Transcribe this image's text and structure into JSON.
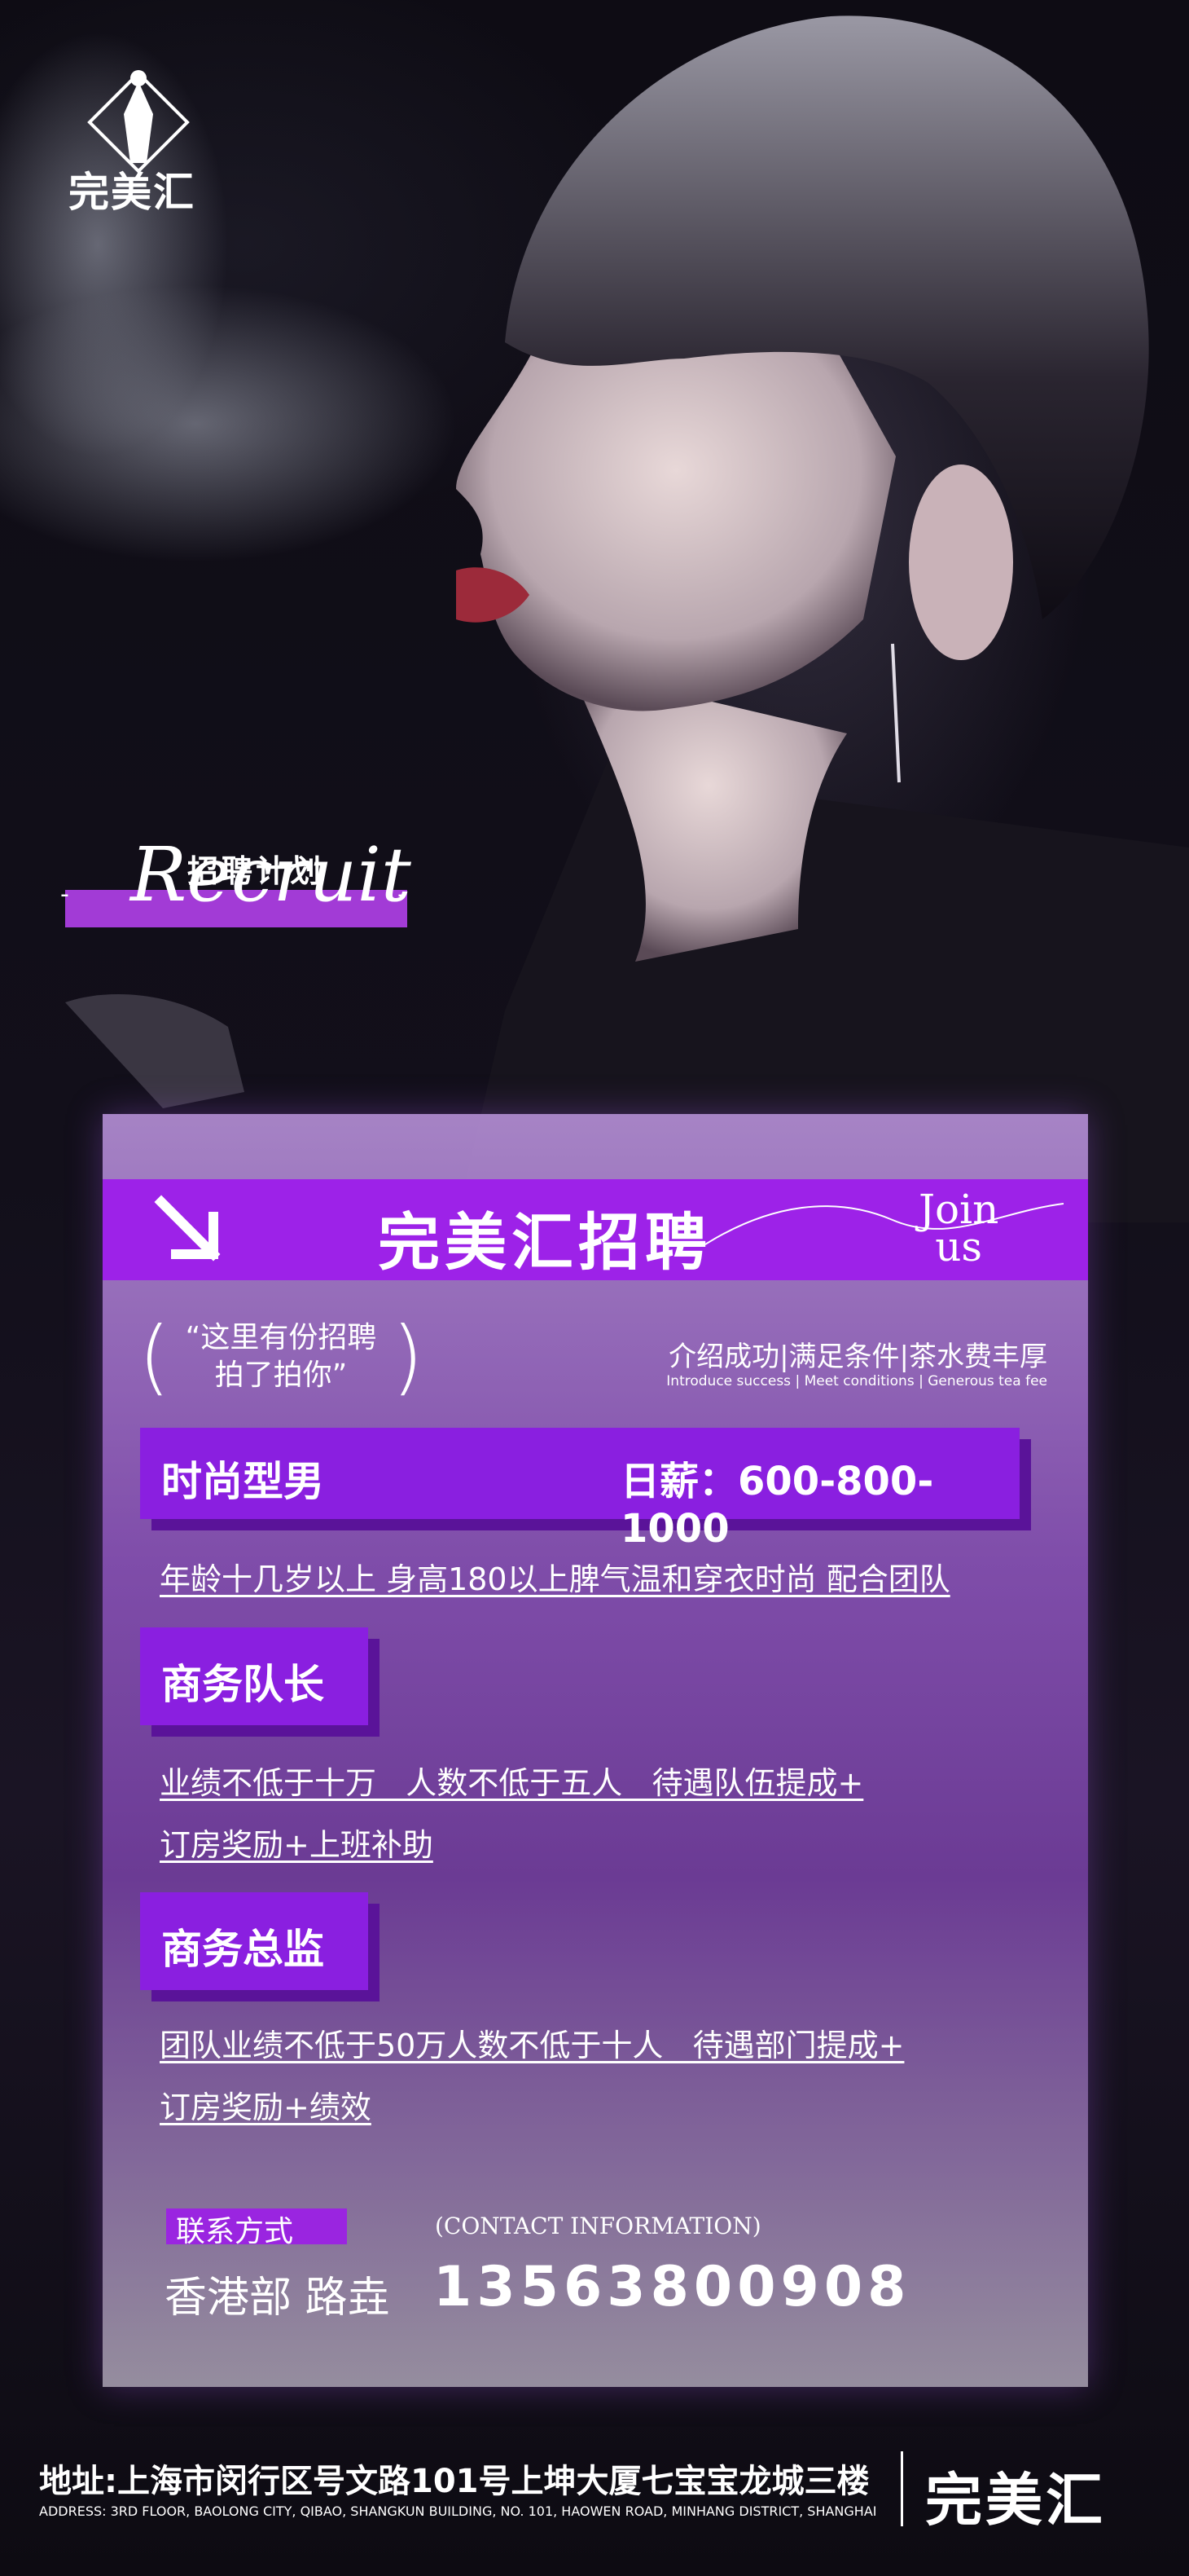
{
  "brand": {
    "logo_text": "完美汇"
  },
  "recruit_badge": {
    "cn": "招聘计划",
    "en": "Recruit",
    "dash": "-"
  },
  "header": {
    "title": "完美汇招聘",
    "join_line1": "Join",
    "join_line2": "us"
  },
  "intro": {
    "quote_line1": "“这里有份招聘",
    "quote_line2": "拍了拍你”",
    "open_paren": "(",
    "close_paren": ")",
    "benefits_cn": "介绍成功|满足条件|茶水费丰厚",
    "benefits_en": "Introduce success | Meet conditions | Generous tea fee"
  },
  "jobs": [
    {
      "title": "时尚型男",
      "salary": "日薪：600-800-1000",
      "req_line1": "年龄十几岁以上 身高180以上脾气温和穿衣时尚 配合团队",
      "req_line2": ""
    },
    {
      "title": "商务队长",
      "salary": "",
      "req_line1": "业绩不低于十万   人数不低于五人   待遇队伍提成+",
      "req_line2": "订房奖励+上班补助"
    },
    {
      "title": "商务总监",
      "salary": "",
      "req_line1": "团队业绩不低于50万人数不低于十人   待遇部门提成+",
      "req_line2": "订房奖励+绩效"
    }
  ],
  "contact": {
    "label": "联系方式",
    "label_en": "(CONTACT INFORMATION)",
    "name": "香港部 路垚",
    "phone": "13563800908"
  },
  "footer": {
    "address_cn": "地址:上海市闵行区号文路101号上坤大厦七宝宝龙城三楼",
    "address_en": "ADDRESS: 3RD FLOOR, BAOLONG CITY, QIBAO, SHANGKUN BUILDING, NO. 101, HAOWEN ROAD, MINHANG DISTRICT, SHANGHAI",
    "brand": "完美汇"
  },
  "colors": {
    "accent_purple": "#9d22e8",
    "panel_shadow": "#5a1399",
    "background": "#0c0a12"
  }
}
